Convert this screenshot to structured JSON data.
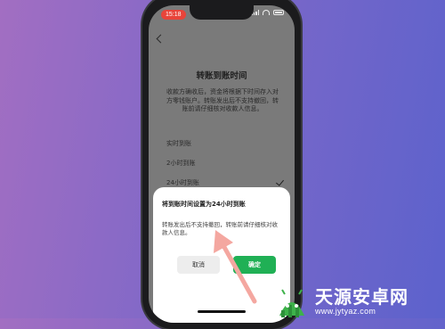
{
  "status_bar": {
    "time": "15:18"
  },
  "page": {
    "title": "转账到账时间",
    "description": "收款方确收后，资金将根据下时间存入对方零钱账户。转账发出后不支持撤回，转账前请仔细核对收款人信息。",
    "options": [
      {
        "label": "实时到账",
        "selected": false
      },
      {
        "label": "2小时到账",
        "selected": false
      },
      {
        "label": "24小时到账",
        "selected": true
      }
    ]
  },
  "dialog": {
    "title": "将到账时间设置为24小时到账",
    "body": "转账发出后不支持撤回，转账前请仔细核对收款人信息。",
    "cancel_label": "取消",
    "confirm_label": "确定"
  },
  "watermark": {
    "name": "天源安卓网",
    "url": "www.jytyaz.com"
  },
  "colors": {
    "accent": "#20b055",
    "time_badge": "#e8443a",
    "arrow": "#f4a7a0"
  },
  "icons": [
    "chevron-left-icon",
    "signal-icon",
    "wifi-icon",
    "battery-icon",
    "checkmark-icon",
    "pointer-arrow-icon",
    "android-logo-icon"
  ]
}
